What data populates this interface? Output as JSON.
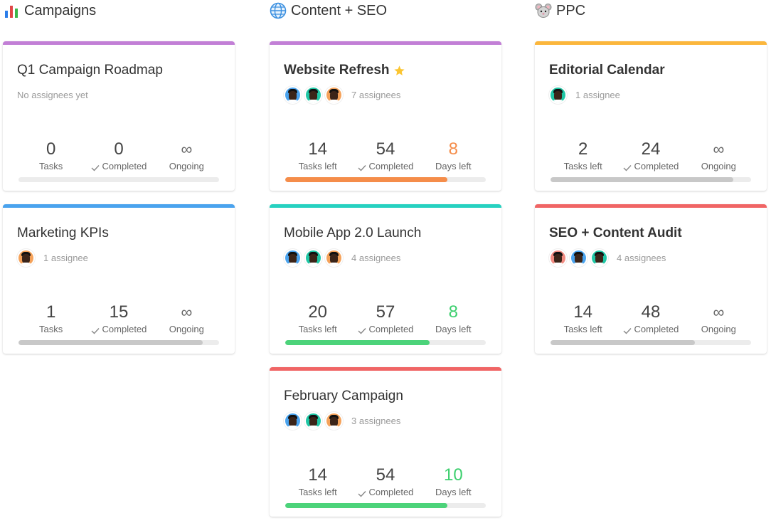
{
  "columns": [
    {
      "title": "Campaigns",
      "icon": "bar-chart-icon",
      "cards": [
        {
          "title": "Q1 Campaign Roadmap",
          "accent": "#c27fd6",
          "bold": false,
          "assignee_text": "No assignees yet",
          "avatars": [],
          "stats": [
            {
              "value": "0",
              "label": "Tasks",
              "check": false,
              "color": "#444"
            },
            {
              "value": "0",
              "label": "Completed",
              "check": true,
              "color": "#444"
            },
            {
              "value": "∞",
              "label": "Ongoing",
              "check": false,
              "color": "#666",
              "inf": true
            }
          ],
          "progress": 0,
          "progress_color": "#c8c8c8"
        },
        {
          "title": "Marketing KPIs",
          "accent": "#4aa3ee",
          "bold": false,
          "assignee_text": "1 assignee",
          "avatars": [
            "#f5a25a"
          ],
          "stats": [
            {
              "value": "1",
              "label": "Tasks",
              "check": false,
              "color": "#444"
            },
            {
              "value": "15",
              "label": "Completed",
              "check": true,
              "color": "#444"
            },
            {
              "value": "∞",
              "label": "Ongoing",
              "check": false,
              "color": "#666",
              "inf": true
            }
          ],
          "progress": 0.92,
          "progress_color": "#c8c8c8"
        }
      ]
    },
    {
      "title": "Content + SEO",
      "icon": "globe-icon",
      "cards": [
        {
          "title": "Website Refresh",
          "star": true,
          "accent": "#c27fd6",
          "bold": true,
          "assignee_text": "7 assignees",
          "avatars": [
            "#4aa3ee",
            "#1fc7a5",
            "#f5a25a"
          ],
          "stats": [
            {
              "value": "14",
              "label": "Tasks left",
              "check": false,
              "color": "#444"
            },
            {
              "value": "54",
              "label": "Completed",
              "check": true,
              "color": "#444"
            },
            {
              "value": "8",
              "label": "Days left",
              "check": false,
              "color": "#f58d4a"
            }
          ],
          "progress": 0.81,
          "progress_color": "#f58d4a"
        },
        {
          "title": "Mobile App 2.0 Launch",
          "accent": "#26d1c0",
          "bold": false,
          "assignee_text": "4 assignees",
          "avatars": [
            "#4aa3ee",
            "#1fc7a5",
            "#f5a25a"
          ],
          "stats": [
            {
              "value": "20",
              "label": "Tasks left",
              "check": false,
              "color": "#444"
            },
            {
              "value": "57",
              "label": "Completed",
              "check": true,
              "color": "#444"
            },
            {
              "value": "8",
              "label": "Days left",
              "check": false,
              "color": "#3ccf6e"
            }
          ],
          "progress": 0.72,
          "progress_color": "#4cd37a"
        },
        {
          "title": "February Campaign",
          "accent": "#f06565",
          "bold": false,
          "assignee_text": "3 assignees",
          "avatars": [
            "#4aa3ee",
            "#1fc7a5",
            "#f5a25a"
          ],
          "stats": [
            {
              "value": "14",
              "label": "Tasks left",
              "check": false,
              "color": "#444"
            },
            {
              "value": "54",
              "label": "Completed",
              "check": true,
              "color": "#444"
            },
            {
              "value": "10",
              "label": "Days left",
              "check": false,
              "color": "#3ccf6e"
            }
          ],
          "progress": 0.81,
          "progress_color": "#4cd37a"
        }
      ]
    },
    {
      "title": "PPC",
      "icon": "mouse-icon",
      "cards": [
        {
          "title": "Editorial Calendar",
          "accent": "#fbb63c",
          "bold": true,
          "assignee_text": "1 assignee",
          "avatars": [
            "#1fc7a5"
          ],
          "stats": [
            {
              "value": "2",
              "label": "Tasks left",
              "check": false,
              "color": "#444"
            },
            {
              "value": "24",
              "label": "Completed",
              "check": true,
              "color": "#444"
            },
            {
              "value": "∞",
              "label": "Ongoing",
              "check": false,
              "color": "#666",
              "inf": true
            }
          ],
          "progress": 0.91,
          "progress_color": "#c8c8c8"
        },
        {
          "title": "SEO + Content Audit",
          "accent": "#f06565",
          "bold": true,
          "assignee_text": "4 assignees",
          "avatars": [
            "#f08a80",
            "#4aa3ee",
            "#1fc7a5"
          ],
          "stats": [
            {
              "value": "14",
              "label": "Tasks left",
              "check": false,
              "color": "#444"
            },
            {
              "value": "48",
              "label": "Completed",
              "check": true,
              "color": "#444"
            },
            {
              "value": "∞",
              "label": "Ongoing",
              "check": false,
              "color": "#666",
              "inf": true
            }
          ],
          "progress": 0.72,
          "progress_color": "#c8c8c8"
        }
      ]
    }
  ]
}
